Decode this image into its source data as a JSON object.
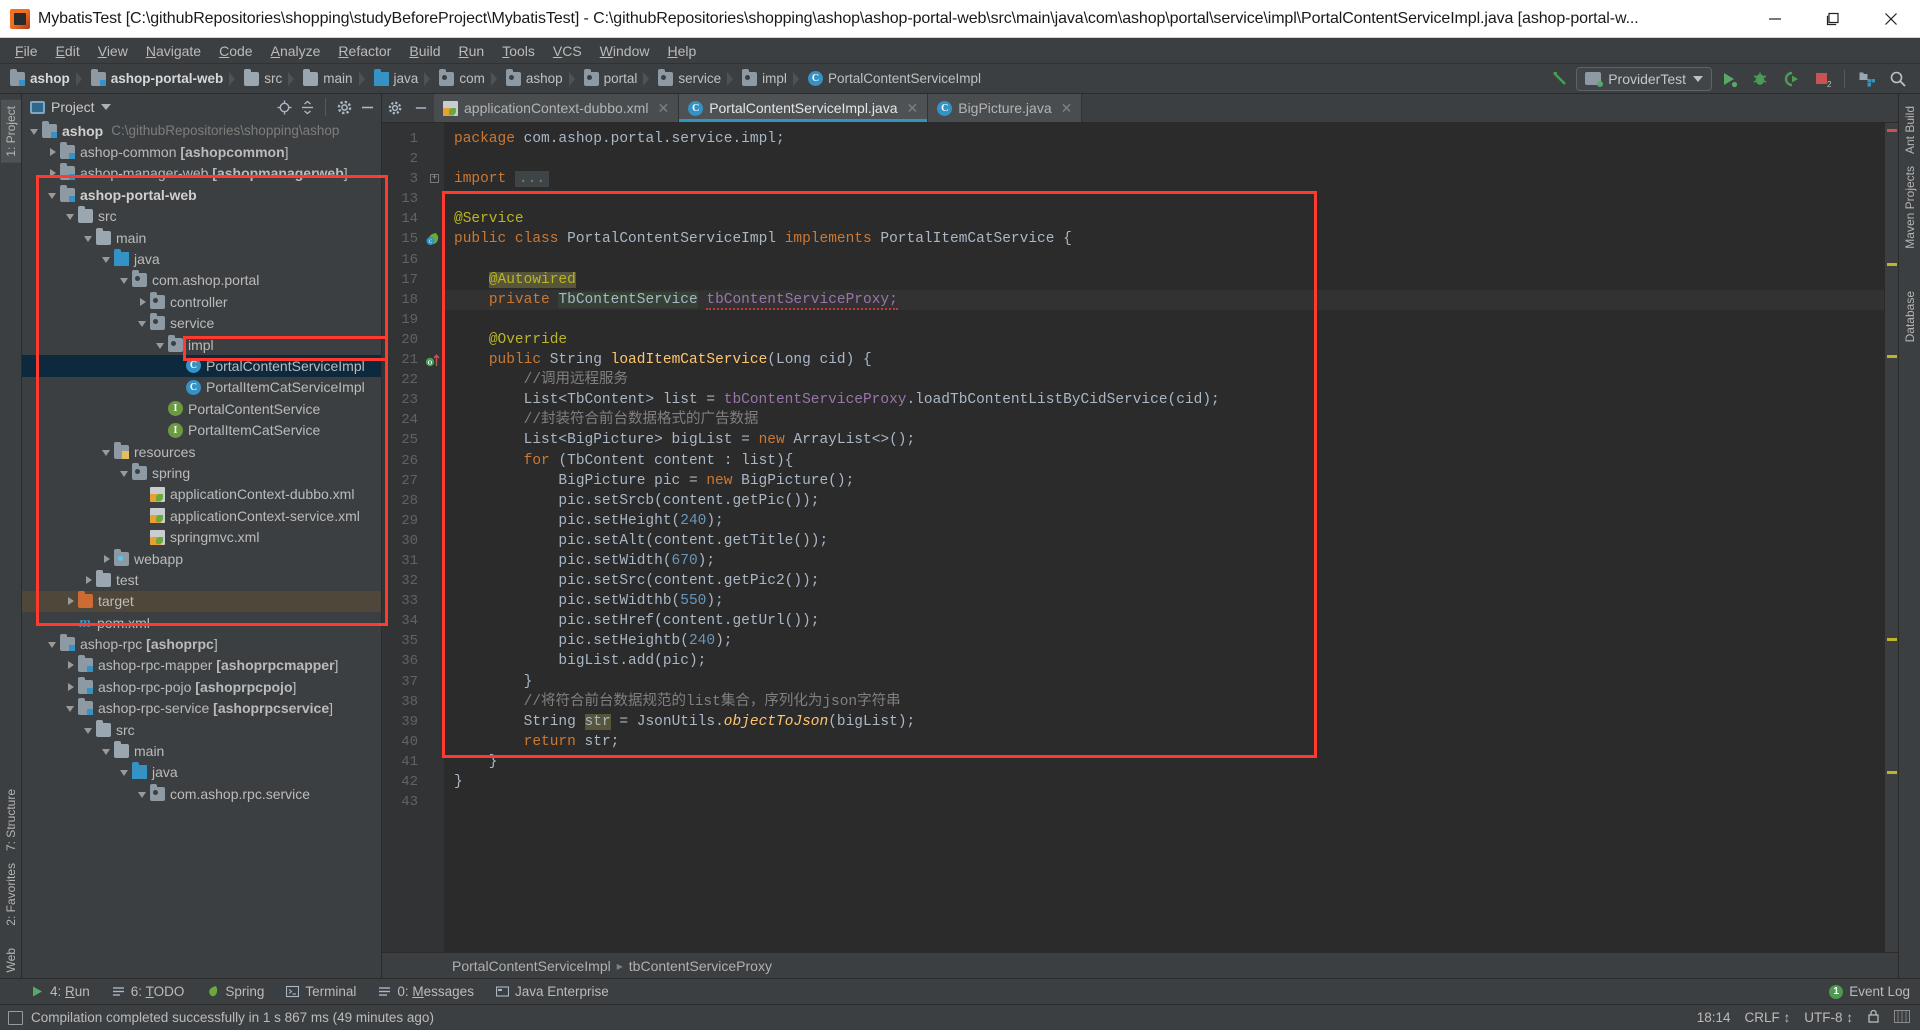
{
  "window": {
    "title": "MybatisTest [C:\\githubRepositories\\shopping\\studyBeforeProject\\MybatisTest] - C:\\githubRepositories\\shopping\\ashop\\ashop-portal-web\\src\\main\\java\\com\\ashop\\portal\\service\\impl\\PortalContentServiceImpl.java [ashop-portal-w...",
    "minimize": "—",
    "maximize": "❐",
    "close": "✕"
  },
  "menubar": {
    "items": [
      "File",
      "Edit",
      "View",
      "Navigate",
      "Code",
      "Analyze",
      "Refactor",
      "Build",
      "Run",
      "Tools",
      "VCS",
      "Window",
      "Help"
    ]
  },
  "breadcrumb": {
    "items": [
      {
        "label": "ashop",
        "icon": "module-icon",
        "bold": true
      },
      {
        "label": "ashop-portal-web",
        "icon": "module-icon",
        "bold": true
      },
      {
        "label": "src",
        "icon": "folder-icon",
        "bold": false
      },
      {
        "label": "main",
        "icon": "folder-icon",
        "bold": false
      },
      {
        "label": "java",
        "icon": "source-folder-icon",
        "bold": false
      },
      {
        "label": "com",
        "icon": "package-icon",
        "bold": false
      },
      {
        "label": "ashop",
        "icon": "package-icon",
        "bold": false
      },
      {
        "label": "portal",
        "icon": "package-icon",
        "bold": false
      },
      {
        "label": "service",
        "icon": "package-icon",
        "bold": false
      },
      {
        "label": "impl",
        "icon": "package-icon",
        "bold": false
      },
      {
        "label": "PortalContentServiceImpl",
        "icon": "class-icon",
        "bold": false
      }
    ],
    "run_configuration": "ProviderTest"
  },
  "toolbar_right": {
    "build_icon": "hammer-icon",
    "run_icon": "run-icon",
    "debug_icon": "debug-icon",
    "run_with_coverage_icon": "coverage-icon",
    "stop_icon": "stop-icon",
    "stop_badge": "2",
    "project_structure_icon": "project-structure-icon",
    "search_icon": "search-icon"
  },
  "project_panel": {
    "title": "Project",
    "header_icons": [
      "locate-icon",
      "collapse-all-icon",
      "settings-gear-icon",
      "hide-icon"
    ],
    "tree": [
      {
        "indent": 0,
        "label": "ashop",
        "sub": "C:\\githubRepositories\\shopping\\ashop",
        "icon": "module-icon",
        "arrow": "open",
        "bold": true
      },
      {
        "indent": 1,
        "label": "ashop-common [ashopcommon]",
        "icon": "module-icon",
        "arrow": "closed",
        "bold": false
      },
      {
        "indent": 1,
        "label": "ashop-manager-web [ashopmanagerweb]",
        "icon": "module-icon",
        "arrow": "closed",
        "bold": false
      },
      {
        "indent": 1,
        "label": "ashop-portal-web",
        "icon": "module-icon",
        "arrow": "open",
        "bold": true
      },
      {
        "indent": 2,
        "label": "src",
        "icon": "folder-icon",
        "arrow": "open",
        "bold": false
      },
      {
        "indent": 3,
        "label": "main",
        "icon": "folder-icon",
        "arrow": "open",
        "bold": false
      },
      {
        "indent": 4,
        "label": "java",
        "icon": "source-folder-icon",
        "arrow": "open",
        "bold": false
      },
      {
        "indent": 5,
        "label": "com.ashop.portal",
        "icon": "package-icon",
        "arrow": "open",
        "bold": false
      },
      {
        "indent": 6,
        "label": "controller",
        "icon": "package-icon",
        "arrow": "closed",
        "bold": false
      },
      {
        "indent": 6,
        "label": "service",
        "icon": "package-icon",
        "arrow": "open",
        "bold": false
      },
      {
        "indent": 7,
        "label": "impl",
        "icon": "package-icon",
        "arrow": "open",
        "bold": false
      },
      {
        "indent": 8,
        "label": "PortalContentServiceImpl",
        "icon": "class-icon",
        "arrow": "none",
        "bold": false,
        "selected": true
      },
      {
        "indent": 8,
        "label": "PortalItemCatServiceImpl",
        "icon": "class-icon",
        "arrow": "none",
        "bold": false
      },
      {
        "indent": 7,
        "label": "PortalContentService",
        "icon": "interface-icon",
        "arrow": "none",
        "bold": false
      },
      {
        "indent": 7,
        "label": "PortalItemCatService",
        "icon": "interface-icon",
        "arrow": "none",
        "bold": false
      },
      {
        "indent": 4,
        "label": "resources",
        "icon": "resources-folder-icon",
        "arrow": "open",
        "bold": false
      },
      {
        "indent": 5,
        "label": "spring",
        "icon": "package-icon",
        "arrow": "open",
        "bold": false
      },
      {
        "indent": 6,
        "label": "applicationContext-dubbo.xml",
        "icon": "spring-xml-icon",
        "arrow": "none",
        "bold": false
      },
      {
        "indent": 6,
        "label": "applicationContext-service.xml",
        "icon": "spring-xml-icon",
        "arrow": "none",
        "bold": false
      },
      {
        "indent": 6,
        "label": "springmvc.xml",
        "icon": "spring-xml-icon",
        "arrow": "none",
        "bold": false
      },
      {
        "indent": 4,
        "label": "webapp",
        "icon": "webapp-folder-icon",
        "arrow": "closed",
        "bold": false
      },
      {
        "indent": 3,
        "label": "test",
        "icon": "folder-icon",
        "arrow": "closed",
        "bold": false
      },
      {
        "indent": 2,
        "label": "target",
        "icon": "target-folder-icon",
        "arrow": "closed",
        "bold": false,
        "highlight": true
      },
      {
        "indent": 2,
        "label": "pom.xml",
        "icon": "maven-icon",
        "arrow": "none",
        "bold": false
      },
      {
        "indent": 1,
        "label": "ashop-rpc [ashoprpc]",
        "icon": "module-icon",
        "arrow": "open",
        "bold": false
      },
      {
        "indent": 2,
        "label": "ashop-rpc-mapper [ashoprpcmapper]",
        "icon": "module-icon",
        "arrow": "closed",
        "bold": false
      },
      {
        "indent": 2,
        "label": "ashop-rpc-pojo [ashoprpcpojo]",
        "icon": "module-icon",
        "arrow": "closed",
        "bold": false
      },
      {
        "indent": 2,
        "label": "ashop-rpc-service [ashoprpcservice]",
        "icon": "module-icon",
        "arrow": "open",
        "bold": false
      },
      {
        "indent": 3,
        "label": "src",
        "icon": "folder-icon",
        "arrow": "open",
        "bold": false
      },
      {
        "indent": 4,
        "label": "main",
        "icon": "folder-icon",
        "arrow": "open",
        "bold": false
      },
      {
        "indent": 5,
        "label": "java",
        "icon": "source-folder-icon",
        "arrow": "open",
        "bold": false
      },
      {
        "indent": 6,
        "label": "com.ashop.rpc.service",
        "icon": "package-icon",
        "arrow": "open",
        "bold": false
      }
    ]
  },
  "left_strip": {
    "tabs": [
      "1: Project",
      "7: Structure",
      "2: Favorites"
    ],
    "bottom_tab": "Web"
  },
  "right_strip": {
    "tabs": [
      "Ant Build",
      "Maven Projects",
      "Database"
    ]
  },
  "editor": {
    "tabs": [
      {
        "label": "applicationContext-dubbo.xml",
        "icon": "spring-xml-icon",
        "active": false,
        "closable": true
      },
      {
        "label": "PortalContentServiceImpl.java",
        "icon": "class-icon",
        "active": true,
        "closable": true
      },
      {
        "label": "BigPicture.java",
        "icon": "class-icon",
        "active": false,
        "closable": true
      }
    ],
    "lines": [
      {
        "n": "1",
        "tokens": [
          {
            "t": "package ",
            "c": "kw"
          },
          {
            "t": "com.ashop.portal.service.impl;",
            "c": "ident"
          }
        ]
      },
      {
        "n": "2",
        "tokens": []
      },
      {
        "n": "3",
        "tokens": [
          {
            "t": "import ",
            "c": "kw"
          },
          {
            "t": "...",
            "c": "fold"
          }
        ],
        "fold": true
      },
      {
        "n": "13",
        "tokens": []
      },
      {
        "n": "14",
        "tokens": [
          {
            "t": "@Service",
            "c": "anno"
          }
        ]
      },
      {
        "n": "15",
        "tokens": [
          {
            "t": "public ",
            "c": "kw"
          },
          {
            "t": "class ",
            "c": "kw"
          },
          {
            "t": "PortalContentServiceImpl ",
            "c": "cls"
          },
          {
            "t": "implements ",
            "c": "kw"
          },
          {
            "t": "PortalItemCatService {",
            "c": "cls"
          }
        ],
        "gutter": "bean-icon"
      },
      {
        "n": "16",
        "tokens": []
      },
      {
        "n": "17",
        "tokens": [
          {
            "t": "    ",
            "c": "ident"
          },
          {
            "t": "@Autowired",
            "c": "annohl"
          }
        ]
      },
      {
        "n": "18",
        "tokens": [
          {
            "t": "    ",
            "c": "ident"
          },
          {
            "t": "private ",
            "c": "kw"
          },
          {
            "t": "TbContentService",
            "c": "fldhl"
          },
          {
            "t": " ",
            "c": "ident"
          },
          {
            "t": "tbContentServiceProxy;",
            "c": "fld squig"
          }
        ],
        "hl": true
      },
      {
        "n": "19",
        "tokens": []
      },
      {
        "n": "20",
        "tokens": [
          {
            "t": "    ",
            "c": "ident"
          },
          {
            "t": "@Override",
            "c": "anno"
          }
        ]
      },
      {
        "n": "21",
        "tokens": [
          {
            "t": "    ",
            "c": "ident"
          },
          {
            "t": "public ",
            "c": "kw"
          },
          {
            "t": "String ",
            "c": "cls"
          },
          {
            "t": "loadItemCatService",
            "c": "meth"
          },
          {
            "t": "(",
            "c": "ident"
          },
          {
            "t": "Long",
            "c": "cls"
          },
          {
            "t": " cid) {",
            "c": "ident"
          }
        ],
        "gutter": "override-icon"
      },
      {
        "n": "22",
        "tokens": [
          {
            "t": "        //调用远程服务",
            "c": "cmt"
          }
        ]
      },
      {
        "n": "23",
        "tokens": [
          {
            "t": "        List<TbContent> list = ",
            "c": "ident"
          },
          {
            "t": "tbContentServiceProxy",
            "c": "fld"
          },
          {
            "t": ".loadTbContentListByCidService(cid);",
            "c": "ident"
          }
        ]
      },
      {
        "n": "24",
        "tokens": [
          {
            "t": "        //封装符合前台数据格式的广告数据",
            "c": "cmt"
          }
        ]
      },
      {
        "n": "25",
        "tokens": [
          {
            "t": "        List<BigPicture> bigList = ",
            "c": "ident"
          },
          {
            "t": "new ",
            "c": "kw"
          },
          {
            "t": "ArrayList<>();",
            "c": "ident"
          }
        ]
      },
      {
        "n": "26",
        "tokens": [
          {
            "t": "        ",
            "c": "ident"
          },
          {
            "t": "for ",
            "c": "kw"
          },
          {
            "t": "(TbContent content : list){",
            "c": "ident"
          }
        ]
      },
      {
        "n": "27",
        "tokens": [
          {
            "t": "            BigPicture pic = ",
            "c": "ident"
          },
          {
            "t": "new ",
            "c": "kw"
          },
          {
            "t": "BigPicture();",
            "c": "ident"
          }
        ]
      },
      {
        "n": "28",
        "tokens": [
          {
            "t": "            pic.setSrcb(content.getPic());",
            "c": "ident"
          }
        ]
      },
      {
        "n": "29",
        "tokens": [
          {
            "t": "            pic.setHeight(",
            "c": "ident"
          },
          {
            "t": "240",
            "c": "num"
          },
          {
            "t": ");",
            "c": "ident"
          }
        ]
      },
      {
        "n": "30",
        "tokens": [
          {
            "t": "            pic.setAlt(content.getTitle());",
            "c": "ident"
          }
        ]
      },
      {
        "n": "31",
        "tokens": [
          {
            "t": "            pic.setWidth(",
            "c": "ident"
          },
          {
            "t": "670",
            "c": "num"
          },
          {
            "t": ");",
            "c": "ident"
          }
        ]
      },
      {
        "n": "32",
        "tokens": [
          {
            "t": "            pic.setSrc(content.getPic2());",
            "c": "ident"
          }
        ]
      },
      {
        "n": "33",
        "tokens": [
          {
            "t": "            pic.setWidthb(",
            "c": "ident"
          },
          {
            "t": "550",
            "c": "num"
          },
          {
            "t": ");",
            "c": "ident"
          }
        ]
      },
      {
        "n": "34",
        "tokens": [
          {
            "t": "            pic.setHref(content.getUrl());",
            "c": "ident"
          }
        ]
      },
      {
        "n": "35",
        "tokens": [
          {
            "t": "            pic.setHeightb(",
            "c": "ident"
          },
          {
            "t": "240",
            "c": "num"
          },
          {
            "t": ");",
            "c": "ident"
          }
        ]
      },
      {
        "n": "36",
        "tokens": [
          {
            "t": "            bigList.add(pic);",
            "c": "ident"
          }
        ]
      },
      {
        "n": "37",
        "tokens": [
          {
            "t": "        }",
            "c": "ident"
          }
        ]
      },
      {
        "n": "38",
        "tokens": [
          {
            "t": "        //将符合前台数据规范的list集合，序列化为json字符串",
            "c": "cmt"
          }
        ]
      },
      {
        "n": "39",
        "tokens": [
          {
            "t": "        ",
            "c": "ident"
          },
          {
            "t": "String ",
            "c": "cls"
          },
          {
            "t": "str",
            "c": "varhl"
          },
          {
            "t": " = JsonUtils.",
            "c": "ident"
          },
          {
            "t": "objectToJson",
            "c": "static-it"
          },
          {
            "t": "(bigList);",
            "c": "ident"
          }
        ]
      },
      {
        "n": "40",
        "tokens": [
          {
            "t": "        ",
            "c": "ident"
          },
          {
            "t": "return ",
            "c": "kw"
          },
          {
            "t": "str;",
            "c": "ident"
          }
        ]
      },
      {
        "n": "41",
        "tokens": [
          {
            "t": "    }",
            "c": "ident"
          }
        ]
      },
      {
        "n": "42",
        "tokens": [
          {
            "t": "}",
            "c": "ident"
          }
        ]
      },
      {
        "n": "43",
        "tokens": []
      }
    ],
    "breadcrumb": [
      "PortalContentServiceImpl",
      "tbContentServiceProxy"
    ]
  },
  "bottom_toolbar": {
    "items": [
      {
        "label": "4: Run",
        "icon": "run-icon"
      },
      {
        "label": "6: TODO",
        "icon": "todo-icon"
      },
      {
        "label": "Spring",
        "icon": "spring-icon"
      },
      {
        "label": "Terminal",
        "icon": "terminal-icon"
      },
      {
        "label": "0: Messages",
        "icon": "messages-icon"
      },
      {
        "label": "Java Enterprise",
        "icon": "java-ee-icon"
      }
    ],
    "event_log": "Event Log",
    "event_log_badge": "1"
  },
  "statusbar": {
    "message": "Compilation completed successfully in 1 s 867 ms (49 minutes ago)",
    "time": "18:14",
    "line_separator": "CRLF ↕",
    "encoding": "UTF-8 ↕",
    "lock_icon": "lock-icon",
    "memory_icon": "memory-indicator"
  },
  "colors": {
    "accent": "#3592c4",
    "annotation_box": "#ff3b30",
    "editor_bg": "#2b2b2b",
    "panel_bg": "#3c3f41",
    "selection": "#0d293e"
  }
}
